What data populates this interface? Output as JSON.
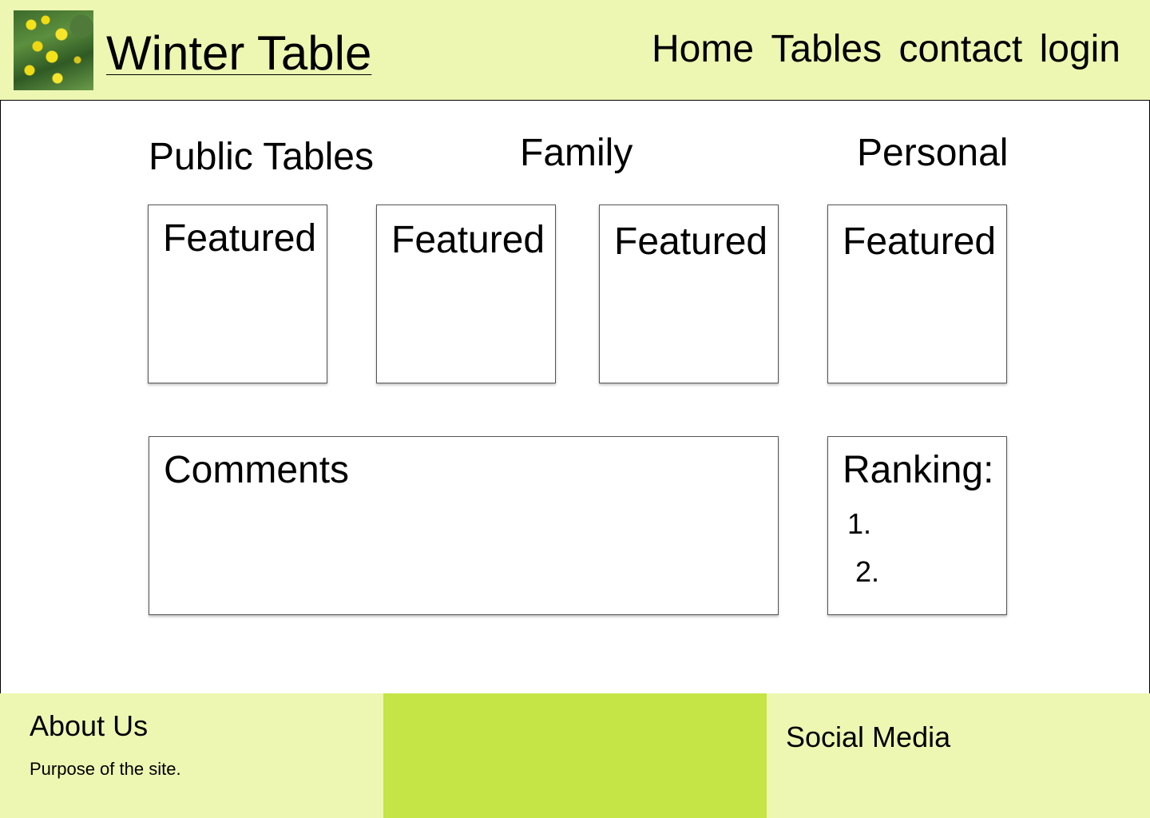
{
  "header": {
    "site_title": "Winter Table",
    "nav": [
      "Home",
      "Tables",
      "contact",
      "login"
    ]
  },
  "main": {
    "columns": [
      "Public Tables",
      "Family",
      "Personal"
    ],
    "featured_label": "Featured",
    "comments": {
      "title": "Comments"
    },
    "ranking": {
      "title": "Ranking:",
      "items": [
        "1.",
        "2."
      ]
    }
  },
  "footer": {
    "about": {
      "title": "About Us",
      "text": "Purpose of the site."
    },
    "social": {
      "title": "Social Media"
    }
  },
  "colors": {
    "header_bg": "#edf7b2",
    "footer_accent": "#c5e445"
  }
}
